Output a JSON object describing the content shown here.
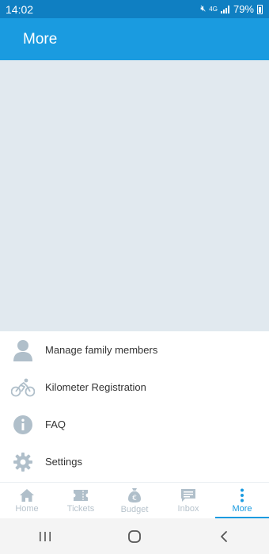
{
  "status_bar": {
    "time": "14:02",
    "network": "4G",
    "battery": "79%"
  },
  "app_bar": {
    "title": "More"
  },
  "menu": {
    "items": [
      {
        "label": "Manage family members",
        "icon": "person-icon"
      },
      {
        "label": "Kilometer Registration",
        "icon": "bicycle-icon"
      },
      {
        "label": "FAQ",
        "icon": "info-icon"
      },
      {
        "label": "Settings",
        "icon": "gear-icon"
      }
    ]
  },
  "bottom_nav": {
    "items": [
      {
        "label": "Home",
        "icon": "home-icon",
        "active": false
      },
      {
        "label": "Tickets",
        "icon": "ticket-icon",
        "active": false
      },
      {
        "label": "Budget",
        "icon": "euro-bag-icon",
        "active": false
      },
      {
        "label": "Inbox",
        "icon": "message-icon",
        "active": false
      },
      {
        "label": "More",
        "icon": "more-vertical-icon",
        "active": true
      }
    ]
  },
  "colors": {
    "status_bar": "#0f7fc2",
    "app_bar": "#1a9be0",
    "content_bg": "#e1e9ef",
    "icon_grey": "#b0bfca",
    "active": "#1a9be0"
  }
}
